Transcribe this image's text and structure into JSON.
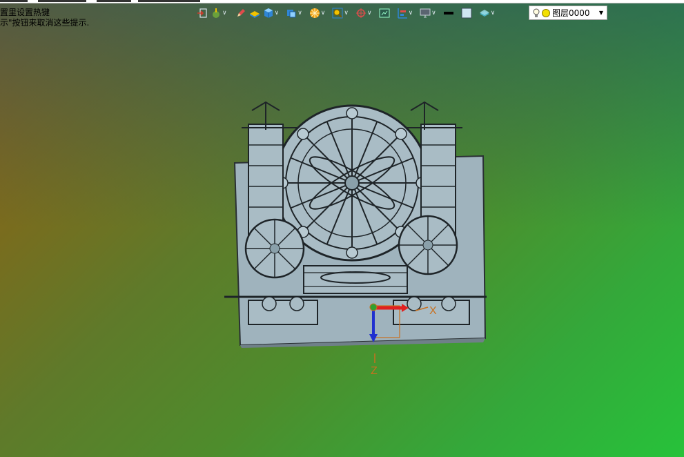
{
  "hint": {
    "line1": "置里设置热键",
    "line2": "示\"按钮来取消这些提示."
  },
  "toolbar": {
    "buttons": [
      {
        "name": "import-icon",
        "color": "#d23a2a"
      },
      {
        "name": "snap-mode-icon",
        "color": "#6aa03c"
      },
      {
        "name": "sketch-pen-icon",
        "color": "#e04b4b"
      },
      {
        "name": "surface-icon",
        "color": "#f2c200"
      },
      {
        "name": "solid-cube-icon",
        "color": "#2f86d6"
      },
      {
        "name": "view-cube-icon",
        "color": "#2f86d6"
      },
      {
        "name": "render-style-icon",
        "color": "#f0a010"
      },
      {
        "name": "zoom-fit-icon",
        "color": "#f2c200"
      },
      {
        "name": "view-orient-icon",
        "color": "#e04b4b"
      },
      {
        "name": "section-view-icon",
        "color": "#3a7d5a"
      },
      {
        "name": "align-icon",
        "color": "#2f86d6"
      },
      {
        "name": "display-monitor-icon",
        "color": "#808890"
      },
      {
        "name": "line-color-icon",
        "color": "#000000"
      },
      {
        "name": "fill-color-icon",
        "color": "#cfe6f2"
      },
      {
        "name": "layer-stack-icon",
        "color": "#4ab0c0"
      }
    ]
  },
  "layer": {
    "label": "图层0000"
  },
  "axes": {
    "x": "X",
    "z": "Z"
  }
}
